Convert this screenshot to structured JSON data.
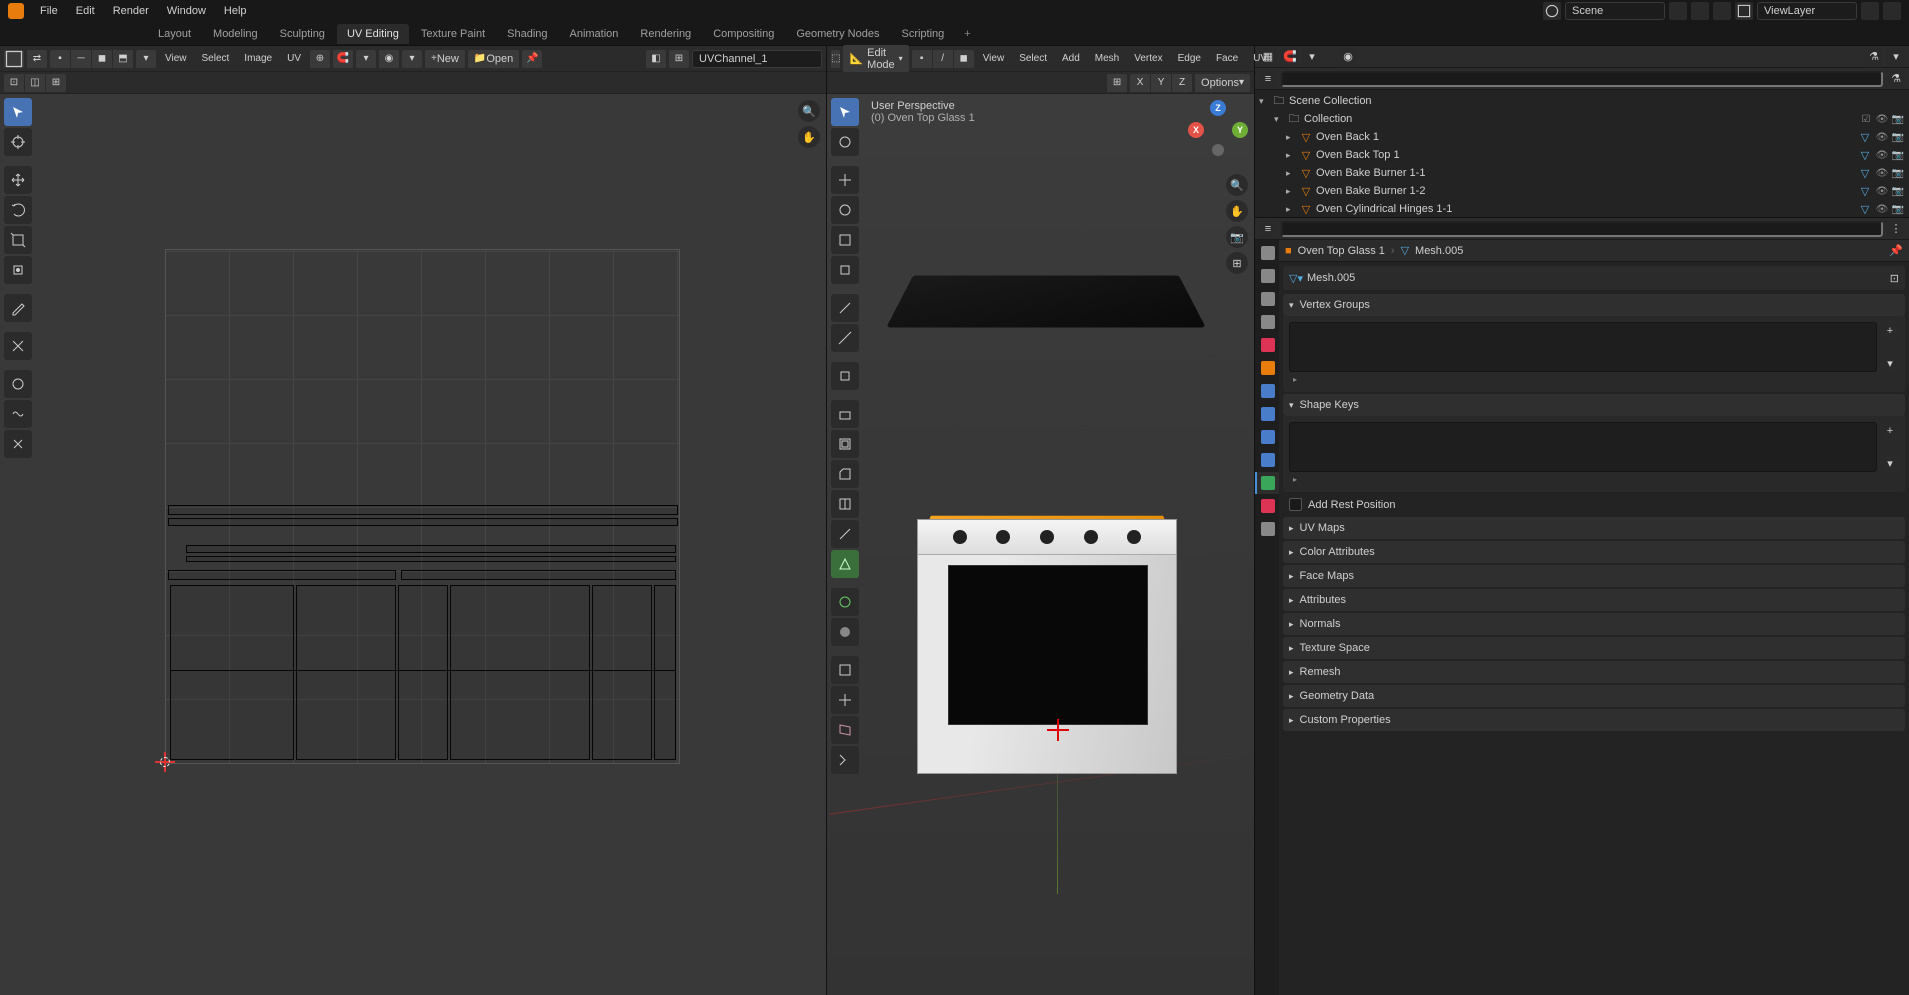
{
  "top_menu": {
    "items": [
      "File",
      "Edit",
      "Render",
      "Window",
      "Help"
    ],
    "scene_label": "Scene",
    "layer_label": "ViewLayer"
  },
  "workspaces": {
    "tabs": [
      "Layout",
      "Modeling",
      "Sculpting",
      "UV Editing",
      "Texture Paint",
      "Shading",
      "Animation",
      "Rendering",
      "Compositing",
      "Geometry Nodes",
      "Scripting"
    ],
    "active": "UV Editing"
  },
  "uv_editor": {
    "header_menus": [
      "View",
      "Select",
      "Image",
      "UV"
    ],
    "new_btn": "New",
    "open_btn": "Open",
    "channel": "UVChannel_1"
  },
  "viewport3d": {
    "mode": "Edit Mode",
    "header_menus": [
      "View",
      "Select",
      "Add",
      "Mesh",
      "Vertex",
      "Edge",
      "Face",
      "UV"
    ],
    "snap_axes": [
      "X",
      "Y",
      "Z"
    ],
    "options": "Options",
    "overlay_line1": "User Perspective",
    "overlay_line2": "(0) Oven Top Glass 1"
  },
  "outliner": {
    "root": "Scene Collection",
    "collection": "Collection",
    "items": [
      "Oven Back 1",
      "Oven Back Top 1",
      "Oven Bake Burner 1-1",
      "Oven Bake Burner 1-2",
      "Oven Cylindrical Hinges 1-1"
    ]
  },
  "properties": {
    "crumb_obj": "Oven Top Glass 1",
    "crumb_mesh": "Mesh.005",
    "mesh_name": "Mesh.005",
    "panels": {
      "vertex_groups": "Vertex Groups",
      "shape_keys": "Shape Keys",
      "add_rest": "Add Rest Position",
      "uv_maps": "UV Maps",
      "color_attrs": "Color Attributes",
      "face_maps": "Face Maps",
      "attributes": "Attributes",
      "normals": "Normals",
      "texture_space": "Texture Space",
      "remesh": "Remesh",
      "geometry_data": "Geometry Data",
      "custom_props": "Custom Properties"
    }
  }
}
